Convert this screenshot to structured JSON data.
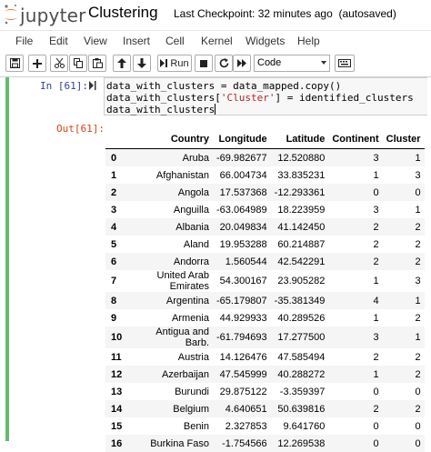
{
  "header": {
    "logo_text": "jupyter",
    "notebook_title": "Clustering",
    "checkpoint": "Last Checkpoint: 32 minutes ago",
    "autosave": "(autosaved)"
  },
  "menu": [
    "File",
    "Edit",
    "View",
    "Insert",
    "Cell",
    "Kernel",
    "Widgets",
    "Help"
  ],
  "toolbar": {
    "run_label": "Run",
    "cell_type": "Code",
    "icons": [
      "save-icon",
      "add-cell-icon",
      "cut-icon",
      "copy-icon",
      "paste-icon",
      "move-up-icon",
      "move-down-icon",
      "run-icon",
      "stop-icon",
      "restart-icon",
      "restart-run-all-icon",
      "command-palette-icon"
    ]
  },
  "cell": {
    "in_prompt": "In [61]:",
    "out_prompt": "Out[61]:",
    "code": {
      "line1": "data_with_clusters = data_mapped.copy()",
      "line2_pre": "data_with_clusters[",
      "line2_str": "'Cluster'",
      "line2_post": "] = identified_clusters",
      "line3": "data_with_clusters"
    }
  },
  "table": {
    "columns": [
      "",
      "Country",
      "Longitude",
      "Latitude",
      "Continent",
      "Cluster"
    ],
    "rows": [
      [
        "0",
        "Aruba",
        "-69.982677",
        "12.520880",
        "3",
        "1"
      ],
      [
        "1",
        "Afghanistan",
        "66.004734",
        "33.835231",
        "1",
        "3"
      ],
      [
        "2",
        "Angola",
        "17.537368",
        "-12.293361",
        "0",
        "0"
      ],
      [
        "3",
        "Anguilla",
        "-63.064989",
        "18.223959",
        "3",
        "1"
      ],
      [
        "4",
        "Albania",
        "20.049834",
        "41.142450",
        "2",
        "2"
      ],
      [
        "5",
        "Aland",
        "19.953288",
        "60.214887",
        "2",
        "2"
      ],
      [
        "6",
        "Andorra",
        "1.560544",
        "42.542291",
        "2",
        "2"
      ],
      [
        "7",
        "United Arab Emirates",
        "54.300167",
        "23.905282",
        "1",
        "3"
      ],
      [
        "8",
        "Argentina",
        "-65.179807",
        "-35.381349",
        "4",
        "1"
      ],
      [
        "9",
        "Armenia",
        "44.929933",
        "40.289526",
        "1",
        "2"
      ],
      [
        "10",
        "Antigua and Barb.",
        "-61.794693",
        "17.277500",
        "3",
        "1"
      ],
      [
        "11",
        "Austria",
        "14.126476",
        "47.585494",
        "2",
        "2"
      ],
      [
        "12",
        "Azerbaijan",
        "47.545999",
        "40.288272",
        "1",
        "2"
      ],
      [
        "13",
        "Burundi",
        "29.875122",
        "-3.359397",
        "0",
        "0"
      ],
      [
        "14",
        "Belgium",
        "4.640651",
        "50.639816",
        "2",
        "2"
      ],
      [
        "15",
        "Benin",
        "2.327853",
        "9.641760",
        "0",
        "0"
      ],
      [
        "16",
        "Burkina Faso",
        "-1.754566",
        "12.269538",
        "0",
        "0"
      ]
    ]
  }
}
